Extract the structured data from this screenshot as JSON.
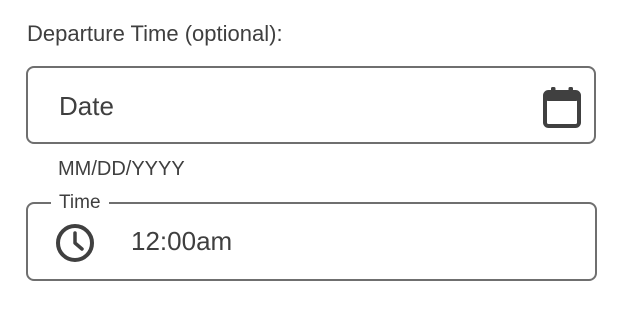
{
  "departure": {
    "section_label": "Departure Time (optional):",
    "date_field": {
      "placeholder": "Date",
      "icon": "calendar-icon",
      "hint": "MM/DD/YYYY"
    },
    "time_field": {
      "label": "Time",
      "icon": "clock-icon",
      "value": "12:00am"
    }
  },
  "colors": {
    "text": "#3f3f3f",
    "border": "#6f6f6f",
    "icon": "#404040",
    "background": "#ffffff"
  }
}
